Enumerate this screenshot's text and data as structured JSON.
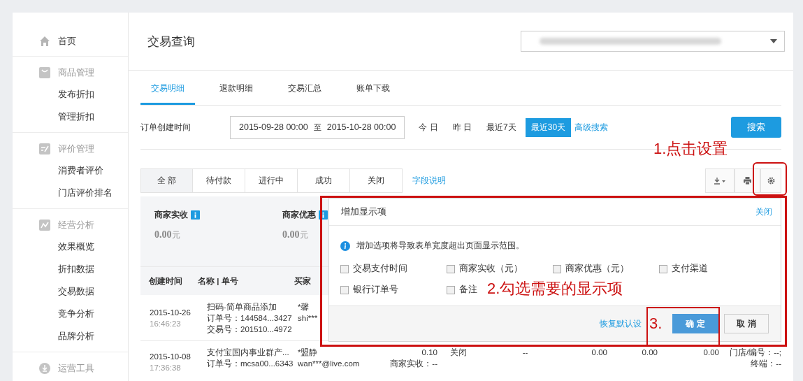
{
  "sidebar": {
    "groups": [
      {
        "label": "首页"
      },
      {
        "label": "商品管理",
        "children": [
          {
            "label": "发布折扣"
          },
          {
            "label": "管理折扣"
          }
        ]
      },
      {
        "label": "评价管理",
        "children": [
          {
            "label": "消费者评价"
          },
          {
            "label": "门店评价排名"
          }
        ]
      },
      {
        "label": "经营分析",
        "children": [
          {
            "label": "效果概览"
          },
          {
            "label": "折扣数据"
          },
          {
            "label": "交易数据"
          },
          {
            "label": "竞争分析"
          },
          {
            "label": "品牌分析"
          }
        ]
      },
      {
        "label": "运营工具"
      }
    ]
  },
  "header": {
    "title": "交易查询"
  },
  "tabs": [
    {
      "label": "交易明细",
      "selected": true
    },
    {
      "label": "退款明细",
      "selected": false
    },
    {
      "label": "交易汇总",
      "selected": false
    },
    {
      "label": "账单下载",
      "selected": false
    }
  ],
  "filter": {
    "label": "订单创建时间",
    "start": "2015-09-28 00:00",
    "separator": "至",
    "end": "2015-10-28 00:00",
    "quick_ranges": [
      {
        "label": "今 日",
        "selected": false
      },
      {
        "label": "昨 日",
        "selected": false
      },
      {
        "label": "最近7天",
        "selected": false
      },
      {
        "label": "最近30天",
        "selected": true
      }
    ],
    "advanced_link": "高级搜索",
    "search_button": "搜索"
  },
  "status_tabs": [
    {
      "label": "全 部",
      "selected": true
    },
    {
      "label": "待付款",
      "selected": false
    },
    {
      "label": "进行中",
      "selected": false
    },
    {
      "label": "成功",
      "selected": false
    },
    {
      "label": "关闭",
      "selected": false
    }
  ],
  "field_help_link": "字段说明",
  "summary": [
    {
      "label": "商家实收",
      "value": "0.00",
      "unit": "元"
    },
    {
      "label": "商家优惠",
      "value": "0.00",
      "unit": "元"
    }
  ],
  "table": {
    "columns": [
      "创建时间",
      "名称 | 单号",
      "买家"
    ],
    "rows": [
      {
        "date": "2015-10-26",
        "time": "16:46:23",
        "name_lines": [
          "扫码-简单商品添加",
          "订单号：144584...3427",
          "交易号：201510...4972"
        ],
        "buyer_lines": [
          "*馨",
          "shi***"
        ]
      },
      {
        "date": "2015-10-08",
        "time": "17:36:38",
        "name_lines": [
          "支付宝国内事业群产...",
          "订单号：mcsa00...6343"
        ],
        "buyer_lines": [
          "*盟静",
          "wan***@live.com"
        ],
        "cells": [
          {
            "lines": [
              "0.10",
              "商家实收：--"
            ]
          },
          {
            "lines": [
              "关闭"
            ]
          },
          {
            "lines": [
              "--"
            ]
          },
          {
            "lines": [
              "0.00"
            ]
          },
          {
            "lines": [
              "0.00"
            ]
          },
          {
            "lines": [
              "0.00"
            ]
          },
          {
            "lines": [
              "门店/编号：--;",
              "终端：--"
            ]
          }
        ]
      }
    ]
  },
  "dialog": {
    "title": "增加显示项",
    "close_link": "关闭",
    "notice": "增加选项将导致表单宽度超出页面显示范围。",
    "options": [
      {
        "label": "交易支付时间",
        "checked": false
      },
      {
        "label": "商家实收（元）",
        "checked": false
      },
      {
        "label": "商家优惠（元）",
        "checked": false
      },
      {
        "label": "支付渠道",
        "checked": false
      },
      {
        "label": "银行订单号",
        "checked": false
      },
      {
        "label": "备注",
        "checked": false
      }
    ],
    "reset_link": "恢复默认设",
    "confirm_button": "确 定",
    "cancel_button": "取 消"
  },
  "annotations": [
    {
      "text": "1.点击设置"
    },
    {
      "text": "2.勾选需要的显示项"
    },
    {
      "text": "3."
    }
  ]
}
